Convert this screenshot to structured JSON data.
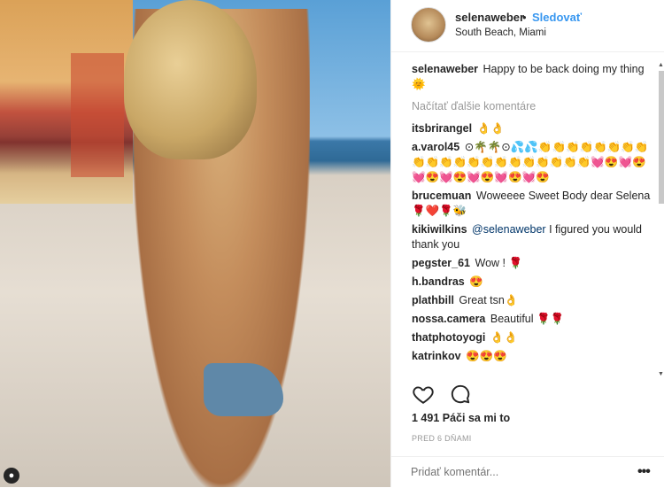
{
  "header": {
    "username": "selenaweber",
    "dot": "•",
    "follow_label": "Sledovať",
    "location": "South Beach, Miami"
  },
  "caption": {
    "user": "selenaweber",
    "text": "Happy to be back doing my thing 🌞"
  },
  "load_more_label": "Načítať ďalšie komentáre",
  "comments": [
    {
      "user": "itsbrirangel",
      "text": "👌👌"
    },
    {
      "user": "a.varol45",
      "text": "⊙🌴🌴⊙💦💦👏👏👏👏👏👏👏👏👏👏👏👏👏👏👏👏👏👏👏👏👏💓😍💓😍💓😍💓😍💓😍💓😍💓😍"
    },
    {
      "user": "brucemuan",
      "text": "Woweeee Sweet Body dear Selena 🌹❤️🌹🐝"
    },
    {
      "user": "kikiwilkins",
      "mention": "@selenaweber",
      "text": "I figured you would thank you"
    },
    {
      "user": "pegster_61",
      "text": "Wow ! 🌹"
    },
    {
      "user": "h.bandras",
      "text": "😍"
    },
    {
      "user": "plathbill",
      "text": "Great tsn👌"
    },
    {
      "user": "nossa.camera",
      "text": "Beautiful 🌹🌹"
    },
    {
      "user": "thatphotoyogi",
      "text": "👌👌"
    },
    {
      "user": "katrinkov",
      "text": "😍😍😍"
    }
  ],
  "likes_text": "1 491 Páči sa mi to",
  "time_ago": "PRED 6 DŇAMI",
  "add_comment_placeholder": "Pridať komentár...",
  "more_options_label": "•••",
  "colors": {
    "link": "#3897f0",
    "text": "#262626",
    "muted": "#999999"
  }
}
